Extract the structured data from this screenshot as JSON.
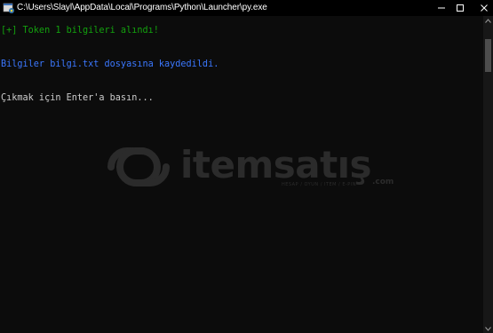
{
  "window": {
    "title": "C:\\Users\\Slayl\\AppData\\Local\\Programs\\Python\\Launcher\\py.exe",
    "icon": "python-launcher-icon",
    "controls": {
      "minimize": "minimize-icon",
      "maximize": "maximize-icon",
      "close": "close-icon"
    }
  },
  "console": {
    "lines": [
      {
        "text": "[+] Token 1 bilgileri alındı!",
        "color": "#13a10e"
      },
      {
        "text": "Bilgiler bilgi.txt dosyasına kaydedildi.",
        "color": "#3b78ff"
      },
      {
        "text": "Çıkmak için Enter'a basın...",
        "color": "#cccccc"
      }
    ]
  },
  "watermark": {
    "brand": "itemsatış",
    "tagline": "HESAP / OYUN / ITEM / E-PIN",
    "domain": ".com"
  },
  "colors": {
    "background": "#0c0c0c",
    "titlebar": "#000000",
    "success": "#13a10e",
    "info": "#3b78ff",
    "default_text": "#cccccc"
  }
}
